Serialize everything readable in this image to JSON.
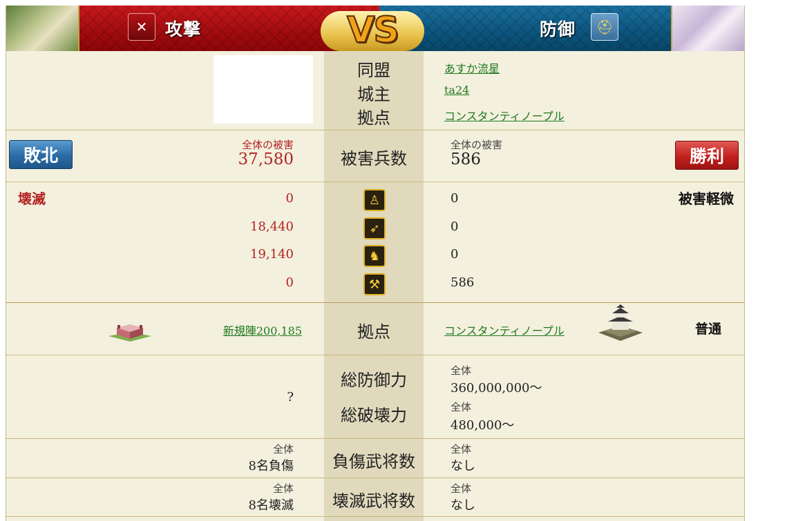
{
  "header": {
    "attack_label": "攻撃",
    "defense_label": "防御",
    "vs_label": "VS",
    "attack_icon": "crossed-swords-icon",
    "defense_icon": "helmet-icon",
    "attack_color": "#b0121a",
    "defense_color": "#0d5680"
  },
  "info": {
    "alliance_label": "同盟",
    "lord_label": "城主",
    "base_label": "拠点",
    "def_alliance": "あすか流星",
    "def_lord": "ta24",
    "def_base": "コンスタンティノープル"
  },
  "damage": {
    "label": "被害兵数",
    "attacker_result": "敗北",
    "defender_result": "勝利",
    "attacker_total_label": "全体の被害",
    "attacker_total": "37,580",
    "defender_total_label": "全体の被害",
    "defender_total": "586",
    "attacker_status": "壊滅",
    "defender_status": "被害軽微",
    "rows": [
      {
        "icon": "spearman-icon",
        "attacker": "0",
        "defender": "0"
      },
      {
        "icon": "archer-icon",
        "attacker": "18,440",
        "defender": "0"
      },
      {
        "icon": "cavalry-icon",
        "attacker": "19,140",
        "defender": "0"
      },
      {
        "icon": "siege-weapon-icon",
        "attacker": "0",
        "defender": "586"
      }
    ]
  },
  "base": {
    "label": "拠点",
    "attacker_base": "新規陣200,185",
    "defender_base": "コンスタンティノープル",
    "defender_level": "普通",
    "attacker_base_icon": "camp-fort-icon",
    "defender_base_icon": "castle-icon"
  },
  "power": {
    "defense_label": "総防御力",
    "destroy_label": "総破壊力",
    "attacker_value": "?",
    "defense_scope": "全体",
    "defense_value": "360,000,000〜",
    "destroy_scope": "全体",
    "destroy_value": "480,000〜"
  },
  "generals": {
    "injured_label": "負傷武将数",
    "destroyed_label": "壊滅武将数",
    "scope": "全体",
    "attacker_injured": "8名負傷",
    "defender_injured": "なし",
    "attacker_destroyed": "8名壊滅",
    "defender_destroyed": "なし"
  }
}
